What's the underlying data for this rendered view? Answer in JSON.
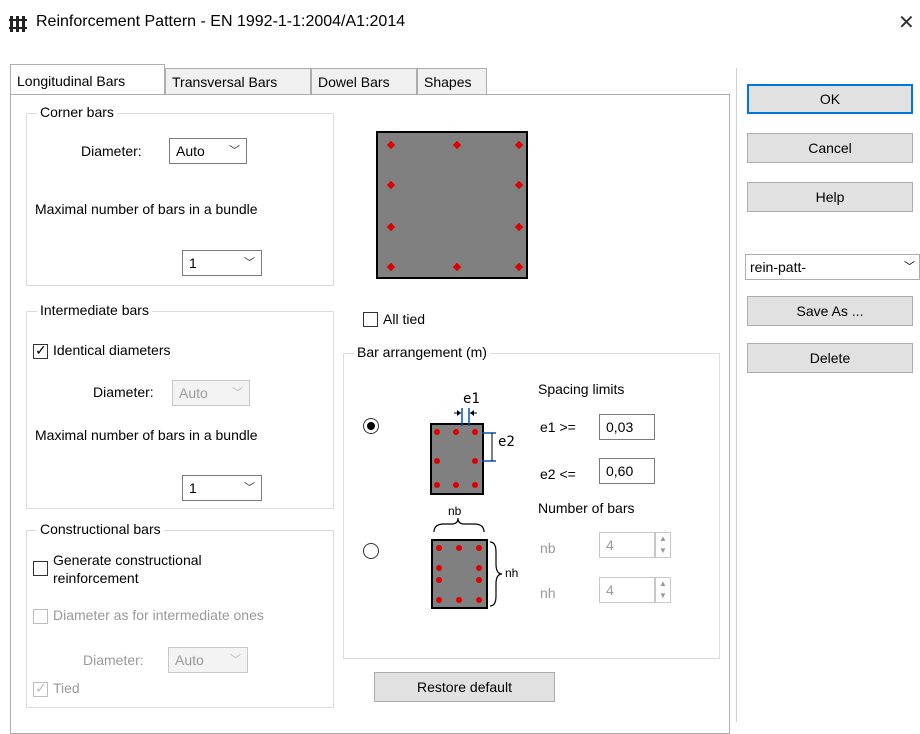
{
  "window": {
    "title": "Reinforcement Pattern - EN 1992-1-1:2004/A1:2014",
    "close_glyph": "✕"
  },
  "tabs": [
    {
      "label": "Longitudinal Bars",
      "active": true
    },
    {
      "label": "Transversal Bars",
      "active": false
    },
    {
      "label": "Dowel Bars",
      "active": false
    },
    {
      "label": "Shapes",
      "active": false
    }
  ],
  "corner": {
    "title": "Corner bars",
    "diameter_label": "Diameter:",
    "diameter_value": "Auto",
    "max_label": "Maximal number of bars in a bundle",
    "max_value": "1"
  },
  "intermediate": {
    "title": "Intermediate bars",
    "identical_label": "Identical diameters",
    "identical_checked": true,
    "diameter_label": "Diameter:",
    "diameter_value": "Auto",
    "max_label": "Maximal number of bars in a bundle",
    "max_value": "1"
  },
  "constructional": {
    "title": "Constructional bars",
    "generate_label": "Generate constructional reinforcement",
    "generate_line1": "Generate constructional",
    "generate_line2": "reinforcement",
    "diameter_as_label": "Diameter as for intermediate ones",
    "diameter_label": "Diameter:",
    "diameter_value": "Auto",
    "tied_label": "Tied"
  },
  "all_tied_label": "All tied",
  "arrangement": {
    "title": "Bar arrangement (m)",
    "spacing_title": "Spacing limits",
    "e1_label": "e1 >=",
    "e1_value": "0,03",
    "e2_label": "e2 <=",
    "e2_value": "0,60",
    "e1_diagram": "e1",
    "e2_diagram": "e2",
    "count_title": "Number of bars",
    "nb_label": "nb",
    "nb_value": "4",
    "nh_label": "nh",
    "nh_value": "4",
    "nb_diagram": "nb",
    "nh_diagram": "nh"
  },
  "restore_label": "Restore default",
  "side": {
    "ok": "OK",
    "cancel": "Cancel",
    "help": "Help",
    "preset": "rein-patt-",
    "save_as": "Save As ...",
    "delete": "Delete"
  },
  "colors": {
    "bar": "#e00000",
    "section": "#808080",
    "accent": "#0078d7"
  }
}
